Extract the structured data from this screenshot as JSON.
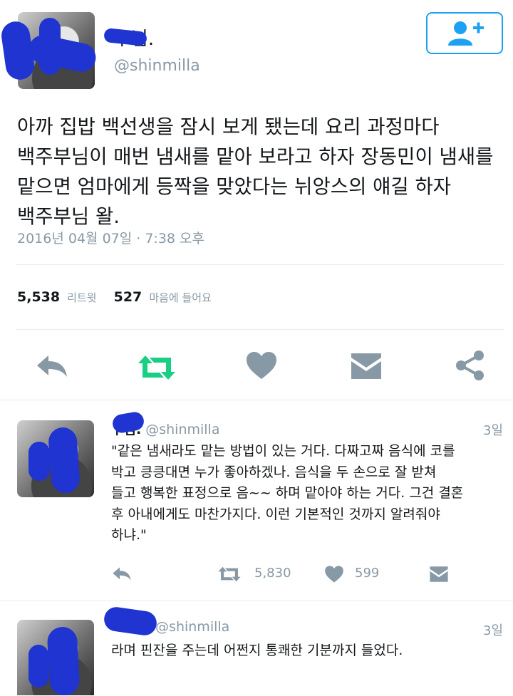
{
  "main_tweet": {
    "display_name": "ㅏ님.",
    "handle": "@shinmilla",
    "follow_button": "follow-user",
    "text": "아까 집밥 백선생을 잠시 보게 됐는데 요리 과정마다\n백주부님이 매번 냄새를 맡아 보라고 하자 장동민이 냄새를\n맡으면 엄마에게 등짝을 맞았다는 뉘앙스의 얘길 하자\n백주부님 왈.",
    "timestamp": "2016년 04월 07일 · 7:38 오후",
    "stats": {
      "retweet_count": "5,538",
      "retweet_label": "리트윗",
      "like_count": "527",
      "like_label": "마음에 들어요"
    },
    "actions": [
      "reply-icon",
      "retweet-icon",
      "heart-icon",
      "dm-icon",
      "share-icon"
    ]
  },
  "replies": [
    {
      "display_name": "ㅏ님.",
      "handle": "@shinmilla",
      "time": "3일",
      "text": "\"같은 냄새라도 맡는 방법이 있는 거다. 다짜고짜 음식에 코를\n박고 킁킁대면 누가 좋아하겠나. 음식을 두 손으로 잘 받쳐\n들고 행복한 표정으로 음~~ 하며 맡아야 하는 거다. 그건 결혼\n후 아내에게도 마찬가지다. 이런 기본적인 것까지 알려줘야\n하냐.\"",
      "retweets": "5,830",
      "likes": "599"
    },
    {
      "display_name": "",
      "handle": "@shinmilla",
      "time": "3일",
      "text": "라며 핀잔을 주는데 어쩐지 통쾌한 기분까지 들었다."
    }
  ],
  "colors": {
    "accent": "#1da1f2",
    "retweet_green": "#19cf86",
    "icon_gray": "#8899a6",
    "text": "#14171a",
    "muted": "#8899a6"
  }
}
